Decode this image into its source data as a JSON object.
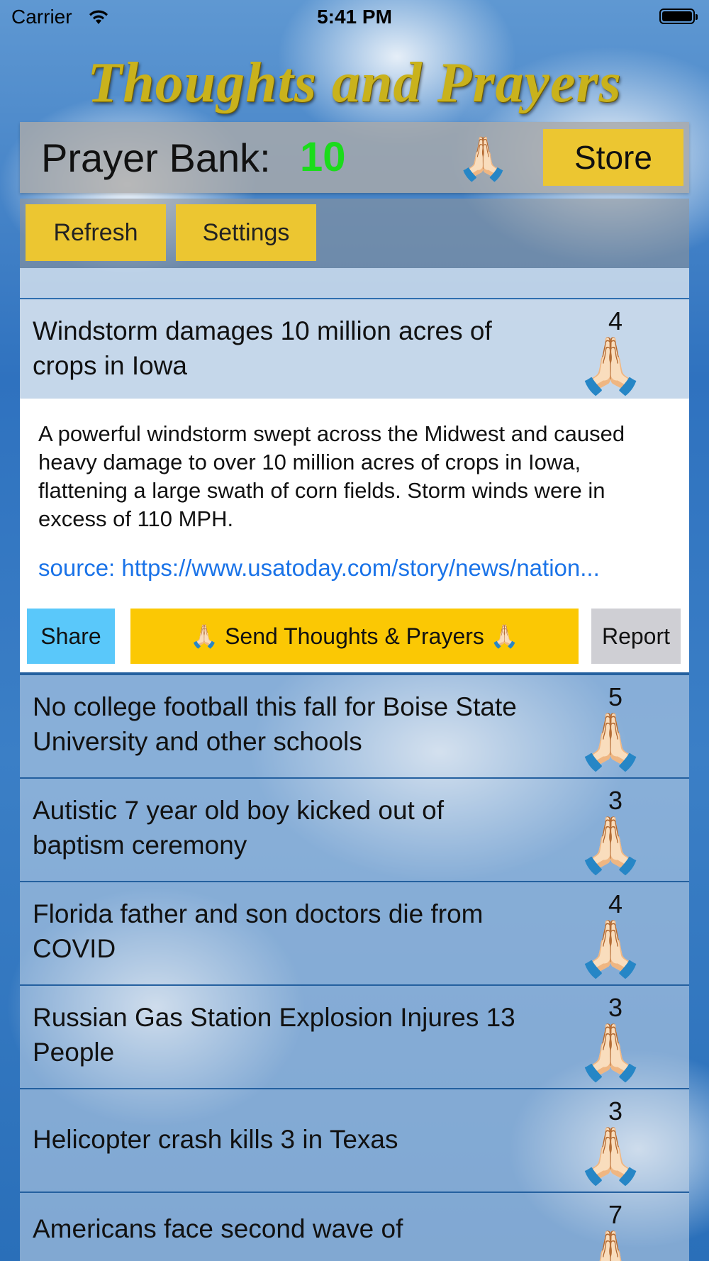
{
  "status_bar": {
    "carrier": "Carrier",
    "time": "5:41 PM"
  },
  "app_title": "Thoughts and Prayers",
  "bank": {
    "label": "Prayer Bank:",
    "count": "10",
    "icon": "🙏🏻",
    "store_label": "Store"
  },
  "toolbar": {
    "refresh_label": "Refresh",
    "settings_label": "Settings"
  },
  "hands_icon": "🙏🏻",
  "expanded_item": {
    "title": "Windstorm damages 10 million acres of crops in Iowa",
    "count": "4",
    "body": "A powerful windstorm swept across the Midwest and caused heavy damage to over 10 million acres of crops in Iowa, flattening a large swath of corn fields. Storm winds were in excess of 110 MPH.",
    "source": "source: https://www.usatoday.com/story/news/nation...",
    "share_label": "Share",
    "send_label": "🙏🏻 Send Thoughts & Prayers 🙏🏻",
    "report_label": "Report"
  },
  "news_items": [
    {
      "title": "No college football this fall for Boise State University and other schools",
      "count": "5"
    },
    {
      "title": "Autistic 7 year old boy kicked out of baptism ceremony",
      "count": "3"
    },
    {
      "title": "Florida father and son doctors die from COVID",
      "count": "4"
    },
    {
      "title": "Russian Gas Station Explosion Injures 13 People",
      "count": "3"
    },
    {
      "title": "Helicopter crash kills 3 in Texas",
      "count": "3"
    },
    {
      "title": "Americans face second wave of",
      "count": "7"
    }
  ],
  "colors": {
    "bank_count": "#1bdc1b",
    "button_yellow": "#ecc631",
    "send_yellow": "#fbc804",
    "share_blue": "#5ac8fa",
    "link_blue": "#1a73e8"
  }
}
